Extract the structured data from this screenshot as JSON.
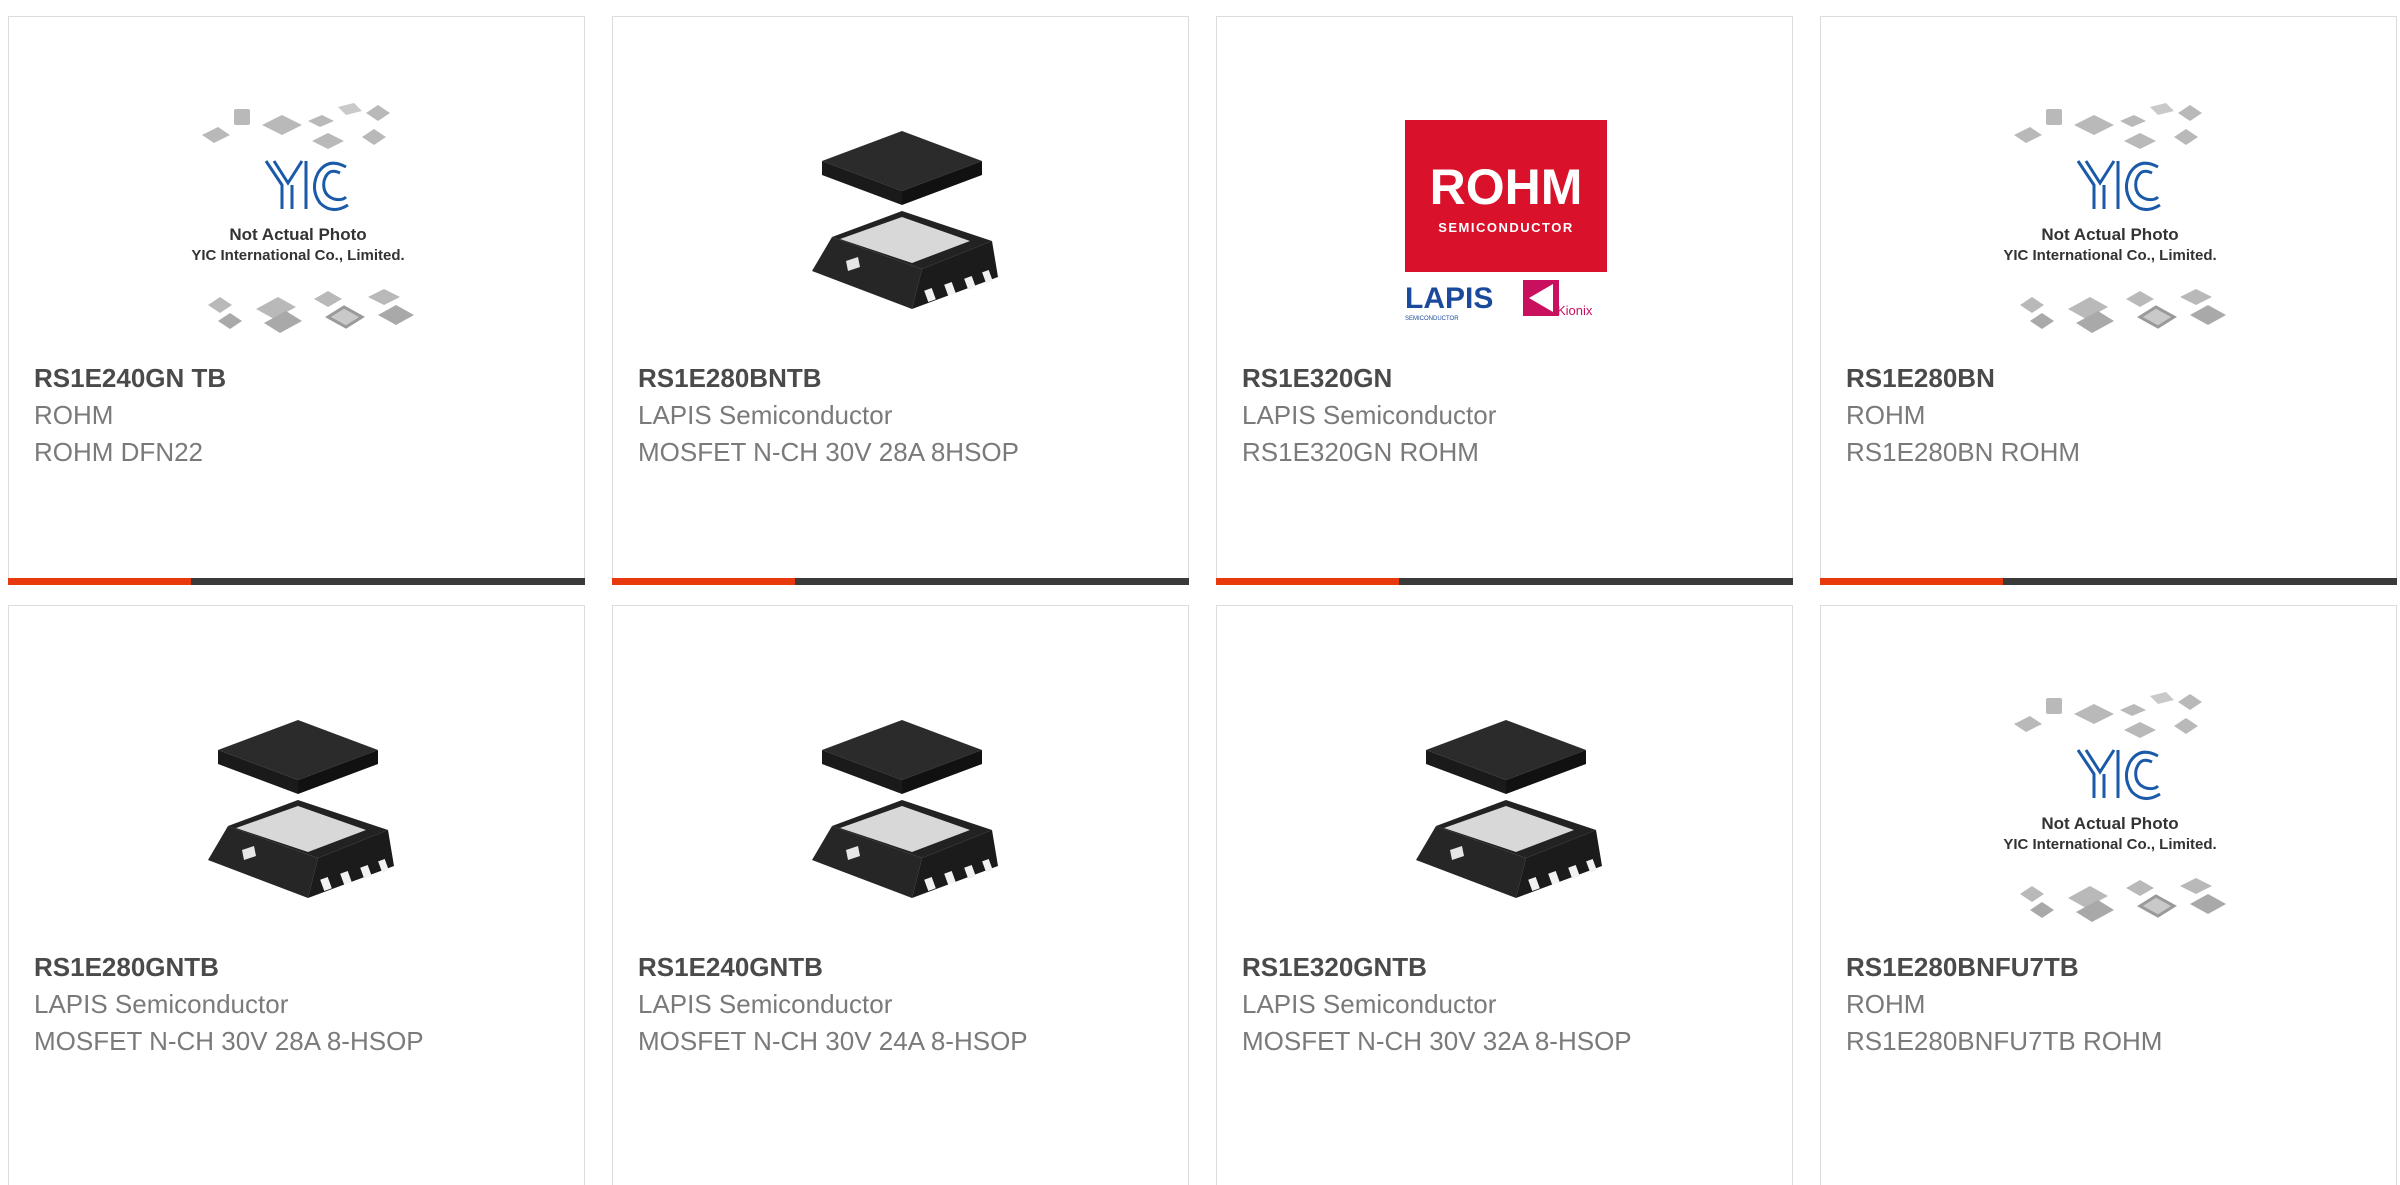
{
  "products": [
    {
      "part_number": "RS1E240GN TB",
      "manufacturer": "ROHM",
      "description": "ROHM DFN22",
      "image": "placeholder-photo"
    },
    {
      "part_number": "RS1E280BNTB",
      "manufacturer": "LAPIS Semiconductor",
      "description": "MOSFET N-CH 30V 28A 8HSOP",
      "image": "hsop-package"
    },
    {
      "part_number": "RS1E320GN",
      "manufacturer": "LAPIS Semiconductor",
      "description": "RS1E320GN ROHM",
      "image": "rohm-logo"
    },
    {
      "part_number": "RS1E280BN",
      "manufacturer": "ROHM",
      "description": "RS1E280BN ROHM",
      "image": "placeholder-photo"
    },
    {
      "part_number": "RS1E280GNTB",
      "manufacturer": "LAPIS Semiconductor",
      "description": "MOSFET N-CH 30V 28A 8-HSOP",
      "image": "hsop-package"
    },
    {
      "part_number": "RS1E240GNTB",
      "manufacturer": "LAPIS Semiconductor",
      "description": "MOSFET N-CH 30V 24A 8-HSOP",
      "image": "hsop-package"
    },
    {
      "part_number": "RS1E320GNTB",
      "manufacturer": "LAPIS Semiconductor",
      "description": "MOSFET N-CH 30V 32A 8-HSOP",
      "image": "hsop-package"
    },
    {
      "part_number": "RS1E280BNFU7TB",
      "manufacturer": "ROHM",
      "description": "RS1E280BNFU7TB ROHM",
      "image": "placeholder-photo"
    }
  ],
  "placeholder": {
    "logo_text": "YIC",
    "line1": "Not Actual Photo",
    "line2": "YIC International Co., Limited."
  },
  "brand_logo": {
    "name": "ROHM",
    "tagline": "SEMICONDUCTOR",
    "sub_brand": "LAPIS",
    "sub_tagline": "SEMICONDUCTOR",
    "partner": "Kionix"
  },
  "colors": {
    "accent": "#e8380d",
    "bar": "#3a3a3a",
    "rohm_red": "#d9112a",
    "lapis_blue": "#1b4a9c",
    "kionix": "#c8105f"
  }
}
